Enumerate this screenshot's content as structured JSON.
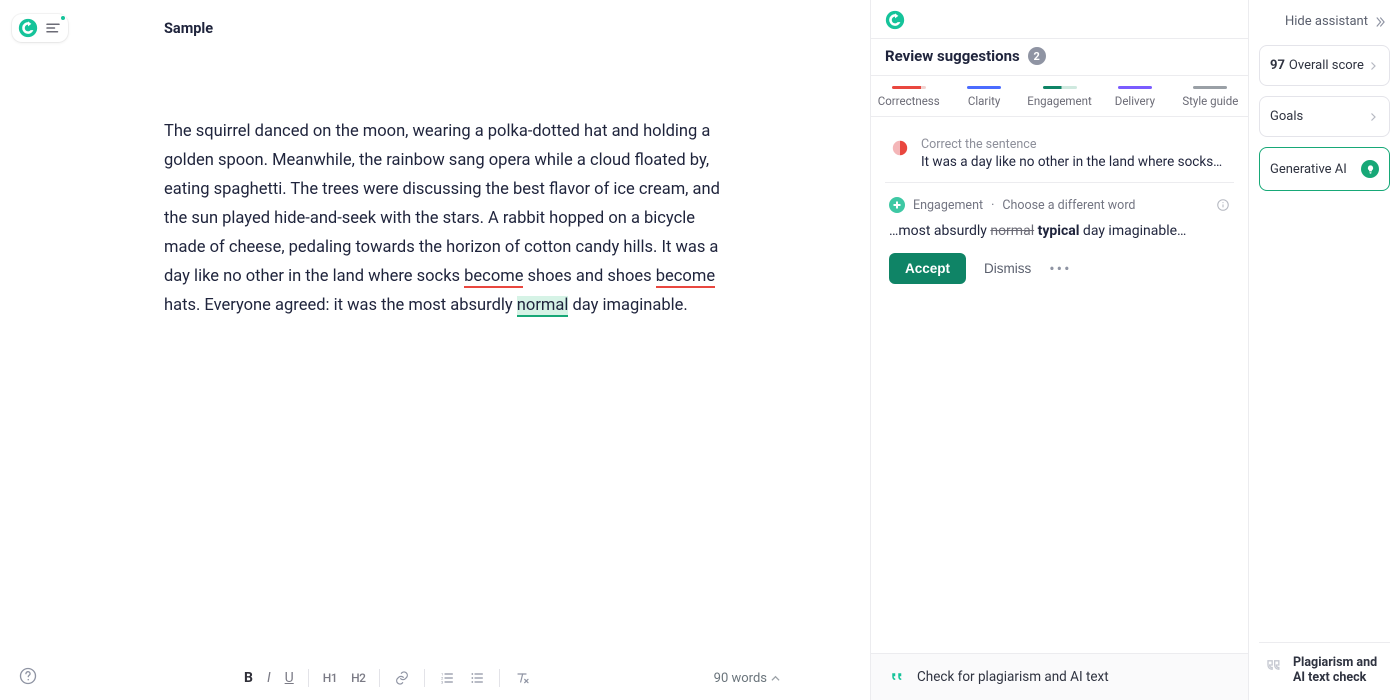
{
  "doc": {
    "title": "Sample",
    "body": {
      "seg1": "The squirrel danced on the moon, wearing a polka-dotted hat and holding a golden spoon. Meanwhile, the rainbow sang opera while a cloud floated by, eating spaghetti. The trees were discussing the best flavor of ice cream, and the sun played hide-and-seek with the stars. A rabbit hopped on a bicycle made of cheese, pedaling towards the horizon of cotton candy hills. It was a day like no other in the land where socks ",
      "underline1": "become",
      "seg2": " shoes and shoes ",
      "underline2": "become",
      "seg3": " hats. Everyone agreed: it was the most absurdly ",
      "highlight": "normal",
      "seg4": " day imaginable."
    },
    "word_count_label": "90 words"
  },
  "toolbar": {
    "bold": "B",
    "italic": "I",
    "underline": "U",
    "h1": "H1",
    "h2": "H2"
  },
  "suggestions": {
    "title": "Review suggestions",
    "count": "2",
    "tabs": {
      "correctness": "Correctness",
      "clarity": "Clarity",
      "engagement": "Engagement",
      "delivery": "Delivery",
      "style": "Style guide"
    },
    "card1": {
      "label": "Correct the sentence",
      "text": "It was a day like no other in the land where socks…"
    },
    "card2": {
      "category": "Engagement",
      "hint": "Choose a different word",
      "pre": "…most absurdly ",
      "old": "normal",
      "new": "typical",
      "post": " day imaginable…",
      "accept": "Accept",
      "dismiss": "Dismiss"
    },
    "footer": "Check for plagiarism and AI text"
  },
  "rail": {
    "hide": "Hide assistant",
    "score_num": "97",
    "score_label": " Overall score",
    "goals": "Goals",
    "gen_ai": "Generative AI",
    "plagiarism_l1": "Plagiarism and",
    "plagiarism_l2": "AI text check"
  },
  "colors": {
    "green": "#17a877",
    "red": "#e9473f",
    "blue": "#4b6cff",
    "purple": "#7a5cff",
    "gray": "#9aa0a6"
  }
}
